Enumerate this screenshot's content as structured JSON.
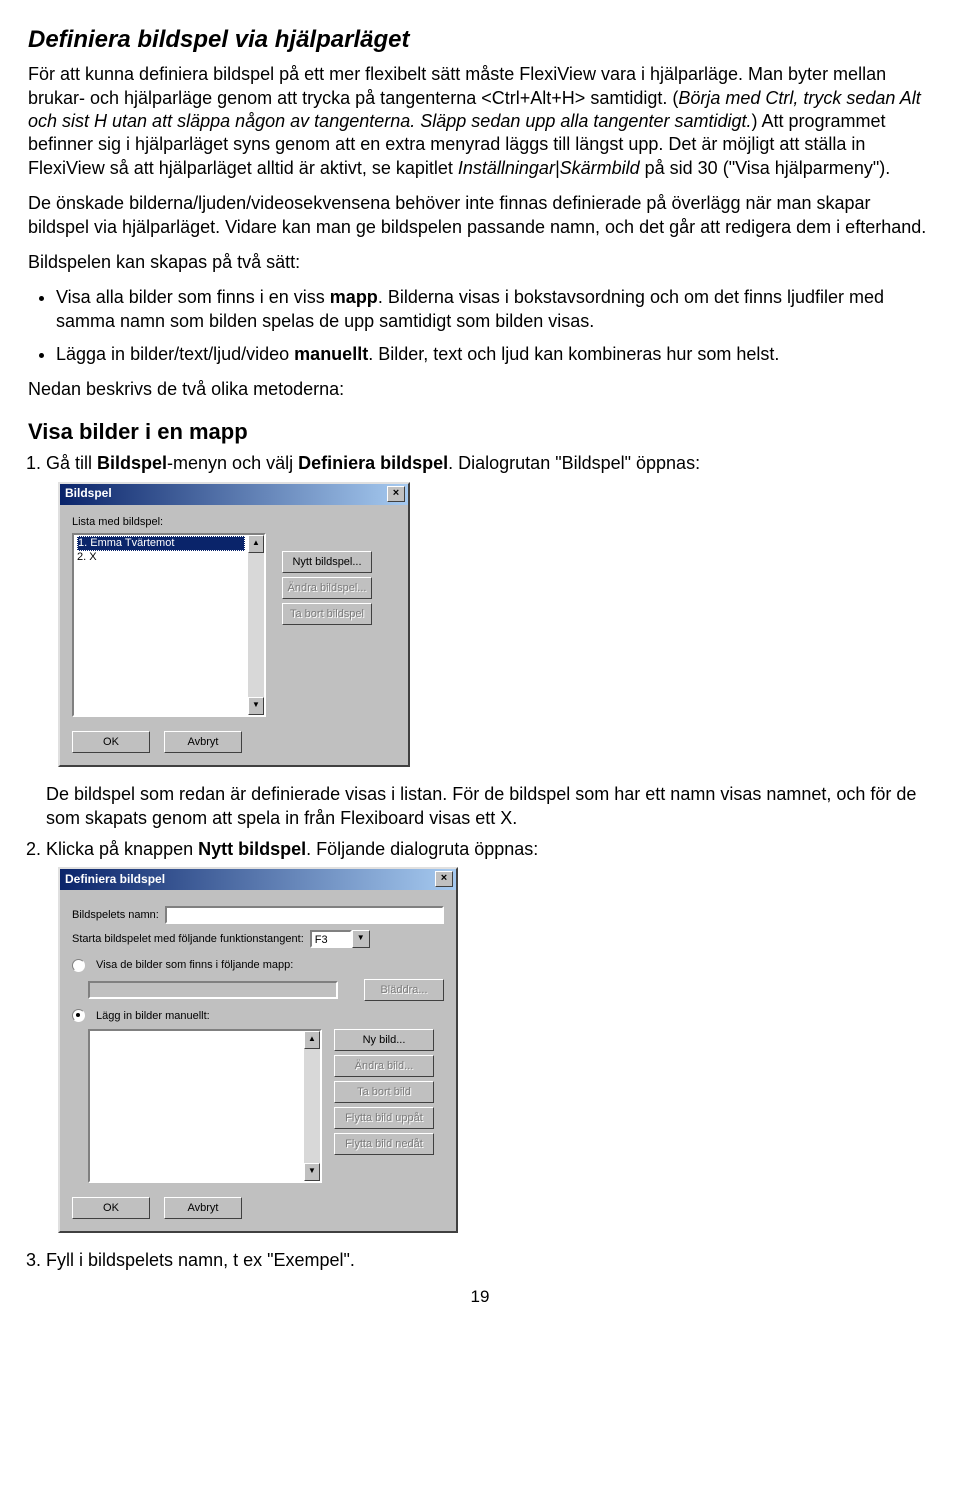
{
  "title": "Definiera bildspel via hjälparläget",
  "para1_a": "För att kunna definiera bildspel på ett mer flexibelt sätt måste FlexiView vara i hjälparläge. Man byter mellan brukar- och hjälparläge genom att trycka på tangenterna <Ctrl+Alt+H> samtidigt. (",
  "para1_italic": "Börja med Ctrl, tryck sedan Alt och sist H utan att släppa någon av tangenterna. Släpp sedan upp alla tangenter samtidigt.",
  "para1_b": ") Att programmet befinner sig i hjälparläget syns genom att en extra menyrad läggs till längst upp. Det är möjligt att ställa in FlexiView så att hjälparläget alltid är aktivt, se kapitlet ",
  "para1_c": "Inställningar|Skärmbild",
  "para1_d": " på sid 30 (\"Visa hjälparmeny\").",
  "para2": "De önskade bilderna/ljuden/videosekvensena behöver inte finnas definierade på överlägg när man skapar bildspel via hjälparläget. Vidare kan man ge bildspelen passande namn, och det går att redigera dem i efterhand.",
  "para3": "Bildspelen kan skapas på två sätt:",
  "bullet1_a": "Visa alla bilder som finns i en viss ",
  "bullet1_b": "mapp",
  "bullet1_c": ". Bilderna visas i bokstavsordning och om det finns ljudfiler med samma namn som bilden spelas de upp samtidigt som bilden visas.",
  "bullet2_a": "Lägga in bilder/text/ljud/video ",
  "bullet2_b": "manuellt",
  "bullet2_c": ". Bilder, text och ljud kan kombineras hur som helst.",
  "para4": "Nedan beskrivs de två olika metoderna:",
  "heading2": "Visa bilder i en mapp",
  "step1_a": "Gå till ",
  "step1_b": "Bildspel",
  "step1_c": "-menyn och välj ",
  "step1_d": "Definiera bildspel",
  "step1_e": ". Dialogrutan \"Bildspel\" öppnas:",
  "dlg1": {
    "title": "Bildspel",
    "close": "×",
    "list_label": "Lista med bildspel:",
    "items": [
      "1. Emma Tvärtemot",
      "2. X"
    ],
    "btn_new": "Nytt bildspel...",
    "btn_edit": "Ändra bildspel...",
    "btn_del": "Ta bort bildspel",
    "btn_ok": "OK",
    "btn_cancel": "Avbryt"
  },
  "after_dlg1": "De bildspel som redan är definierade visas i listan. För de bildspel som har ett namn visas namnet, och för de som skapats genom att spela in från Flexiboard visas ett X.",
  "step2_a": "Klicka på knappen ",
  "step2_b": "Nytt bildspel",
  "step2_c": ". Följande dialogruta öppnas:",
  "dlg2": {
    "title": "Definiera bildspel",
    "close": "×",
    "name_label": "Bildspelets namn:",
    "name_value": "",
    "fkey_label": "Starta bildspelet med följande funktionstangent:",
    "fkey_value": "F3",
    "opt_folder": "Visa de bilder som finns i följande mapp:",
    "btn_browse": "Bläddra...",
    "opt_manual": "Lägg in bilder manuellt:",
    "btn_new_img": "Ny bild...",
    "btn_edit_img": "Ändra bild...",
    "btn_del_img": "Ta bort bild",
    "btn_up": "Flytta bild uppåt",
    "btn_down": "Flytta bild nedåt",
    "btn_ok": "OK",
    "btn_cancel": "Avbryt"
  },
  "step3": "Fyll i bildspelets namn, t ex \"Exempel\".",
  "page_number": "19"
}
